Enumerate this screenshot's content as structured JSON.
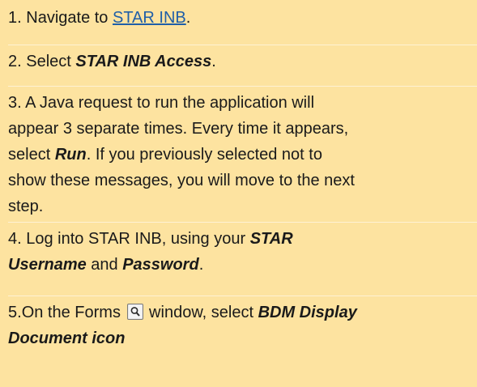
{
  "steps": [
    {
      "num": "1. ",
      "pre": "Navigate to ",
      "link": "STAR INB",
      "post": "."
    },
    {
      "num": "2. ",
      "pre": "Select ",
      "em": "STAR INB Access",
      "post": "."
    },
    {
      "num": "3. ",
      "line1": "A Java request to run the application will",
      "line2": "appear 3 separate times. Every time it appears,",
      "line3_pre": "select ",
      "line3_em": "Run",
      "line3_post": ". If you previously selected not to",
      "line4": "show these messages, you will move to the next",
      "line5": "step."
    },
    {
      "num": "4. ",
      "pre": "Log into STAR INB, using your ",
      "em1": "STAR",
      "em2": "Username",
      "mid": " and ",
      "em3": "Password",
      "post": "."
    },
    {
      "num": "5.",
      "pre": "On the Forms ",
      "icon": "search-magnifier-icon",
      "mid": " window, select ",
      "em1": "BDM Display",
      "em2": "Document icon"
    }
  ]
}
